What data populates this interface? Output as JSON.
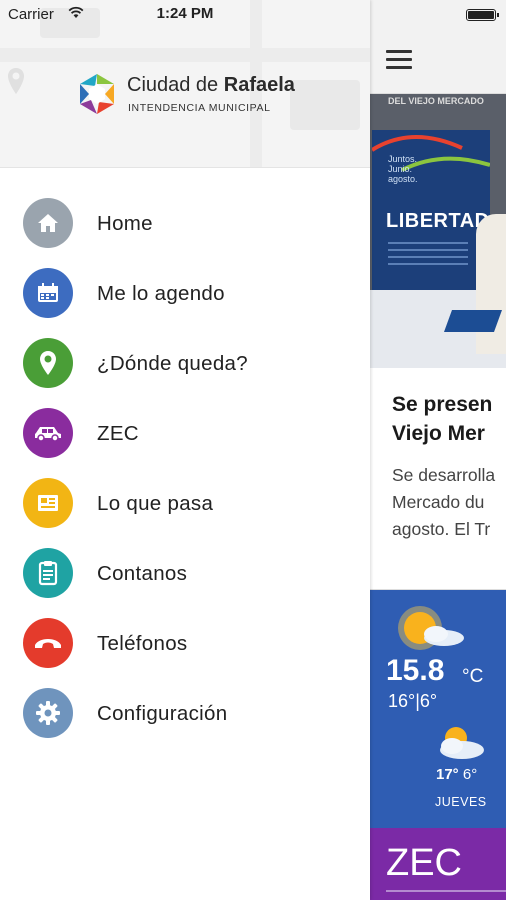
{
  "status_bar": {
    "carrier": "Carrier",
    "time": "1:24 PM",
    "wifi_icon": "wifi-icon",
    "battery_icon": "battery-icon"
  },
  "drawer": {
    "brand": {
      "name_regular": "Ciudad de ",
      "name_bold": "Rafaela",
      "subtitle": "INTENDENCIA MUNICIPAL"
    },
    "menu": [
      {
        "label": "Home",
        "icon": "home-icon",
        "color": "#9aa4ae"
      },
      {
        "label": "Me lo agendo",
        "icon": "calendar-icon",
        "color": "#3d6cc0"
      },
      {
        "label": "¿Dónde queda?",
        "icon": "location-pin-icon",
        "color": "#4a9e37"
      },
      {
        "label": "ZEC",
        "icon": "car-icon",
        "color": "#8a2c9e"
      },
      {
        "label": "Lo que pasa",
        "icon": "newspaper-icon",
        "color": "#f2b514"
      },
      {
        "label": "Contanos",
        "icon": "clipboard-icon",
        "color": "#1fa3a3"
      },
      {
        "label": "Teléfonos",
        "icon": "phone-icon",
        "color": "#e43b2c"
      },
      {
        "label": "Configuración",
        "icon": "gear-icon",
        "color": "#6f94bd"
      }
    ]
  },
  "content": {
    "menu_icon": "hamburger-icon",
    "photo": {
      "caption": "DEL VIEJO MERCADO",
      "banner_small": "Juntos.\nJunio.\nagosto.",
      "banner_title": "LIBERTAD"
    },
    "news": {
      "title_line1": "Se presen",
      "title_line2": "Viejo Mer",
      "body_line1": "Se desarrolla",
      "body_line2": "Mercado du",
      "body_line3": "agosto. El Tr"
    },
    "weather": {
      "temp": "15.8",
      "unit": "°C",
      "minmax": "16°|6°",
      "forecast_max": "17°",
      "forecast_min": "6°",
      "forecast_day": "JUEVES"
    },
    "zec_label": "ZEC"
  },
  "colors": {
    "weather_bg": "#2f5db3",
    "zec_bg": "#7b2aa6",
    "header_bg": "#f4f4f4"
  }
}
